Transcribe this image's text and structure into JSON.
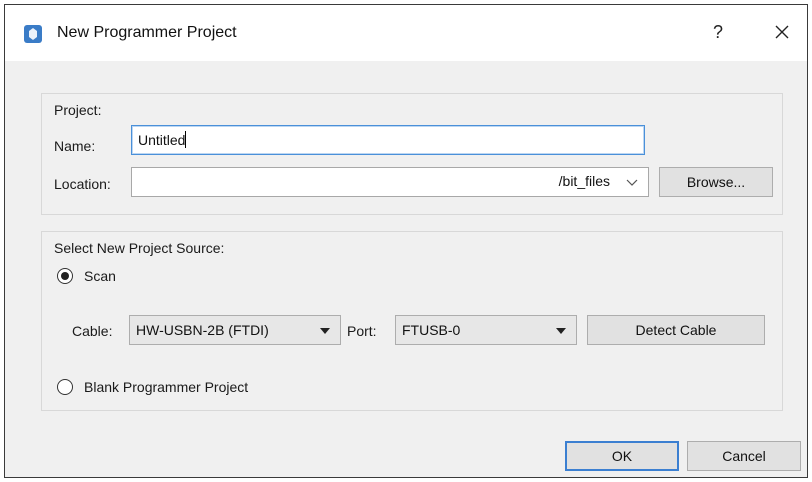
{
  "window": {
    "title": "New Programmer Project",
    "help_label": "?"
  },
  "project": {
    "group_title": "Project:",
    "name_label": "Name:",
    "name_value": "Untitled",
    "location_label": "Location:",
    "location_value": "",
    "location_suffix": "/bit_files",
    "browse_label": "Browse..."
  },
  "source": {
    "group_title": "Select New Project Source:",
    "scan_label": "Scan",
    "scan_selected": true,
    "cable_label": "Cable:",
    "cable_value": "HW-USBN-2B (FTDI)",
    "port_label": "Port:",
    "port_value": "FTUSB-0",
    "detect_label": "Detect Cable",
    "blank_label": "Blank Programmer Project"
  },
  "footer": {
    "ok_label": "OK",
    "cancel_label": "Cancel"
  },
  "colors": {
    "accent": "#3b7fd1",
    "focus_border": "#4a90d9",
    "dialog_bg": "#f0f0f0",
    "icon_blue": "#3a7cc7"
  }
}
